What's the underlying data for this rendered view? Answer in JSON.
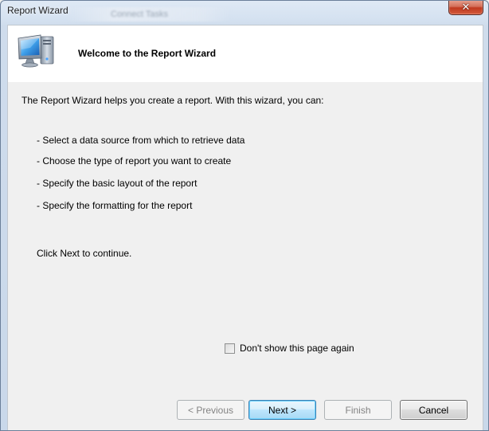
{
  "window": {
    "title": "Report Wizard",
    "background_title_ghost": "Connect Tasks",
    "close_glyph": "✕",
    "close_icon": "close-icon"
  },
  "header": {
    "icon": "computer-monitor-icon",
    "title": "Welcome to the Report Wizard"
  },
  "content": {
    "intro": "The Report Wizard helps you create a report. With this wizard, you can:",
    "bullets": [
      "- Select a data source from which to retrieve data",
      "- Choose the type of report you want to create",
      "- Specify the basic layout of the report",
      "- Specify the formatting for the report"
    ],
    "continue_text": "Click Next to continue."
  },
  "checkbox": {
    "label": "Don't show this page again",
    "checked": false
  },
  "buttons": {
    "previous": "< Previous",
    "next": "Next >",
    "finish": "Finish",
    "cancel": "Cancel"
  },
  "colors": {
    "default_button_border": "#3c7fb1",
    "close_button_red": "#c0391f",
    "header_background": "#ffffff",
    "client_background": "#f0f0f0"
  }
}
